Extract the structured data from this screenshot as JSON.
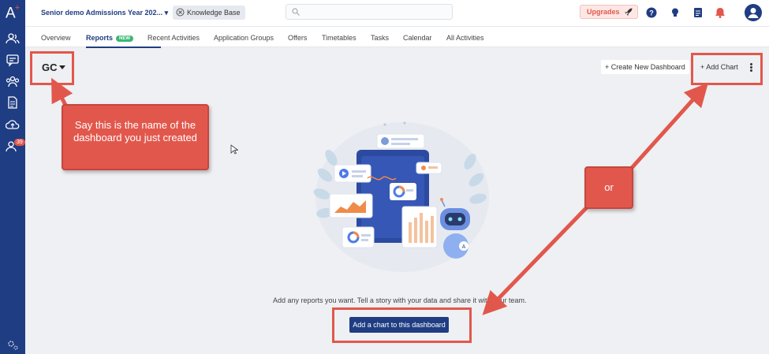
{
  "topbar": {
    "program_selector": "Senior demo Admissions Year 202...",
    "knowledge_base": "Knowledge Base",
    "upgrades": "Upgrades"
  },
  "sidebar": {
    "logo": "A",
    "badge_count": "39"
  },
  "tabs": {
    "overview": "Overview",
    "reports": "Reports",
    "reports_badge": "NEW",
    "recent_activities": "Recent Activities",
    "application_groups": "Application Groups",
    "offers": "Offers",
    "timetables": "Timetables",
    "tasks": "Tasks",
    "calendar": "Calendar",
    "all_activities": "All Activities"
  },
  "dashboard": {
    "name": "GC",
    "create_new_dashboard": "+ Create New Dashboard",
    "add_chart": "+ Add Chart",
    "empty_message": "Add any reports you want. Tell a story with your data and share it with your team.",
    "add_chart_button": "Add a chart to this dashboard"
  },
  "annotations": {
    "callout_name": "Say this is the name of the dashboard you just created",
    "callout_or": "or"
  },
  "colors": {
    "primary": "#1f3d82",
    "annotation": "#e2574c",
    "new_badge": "#3bb873"
  }
}
